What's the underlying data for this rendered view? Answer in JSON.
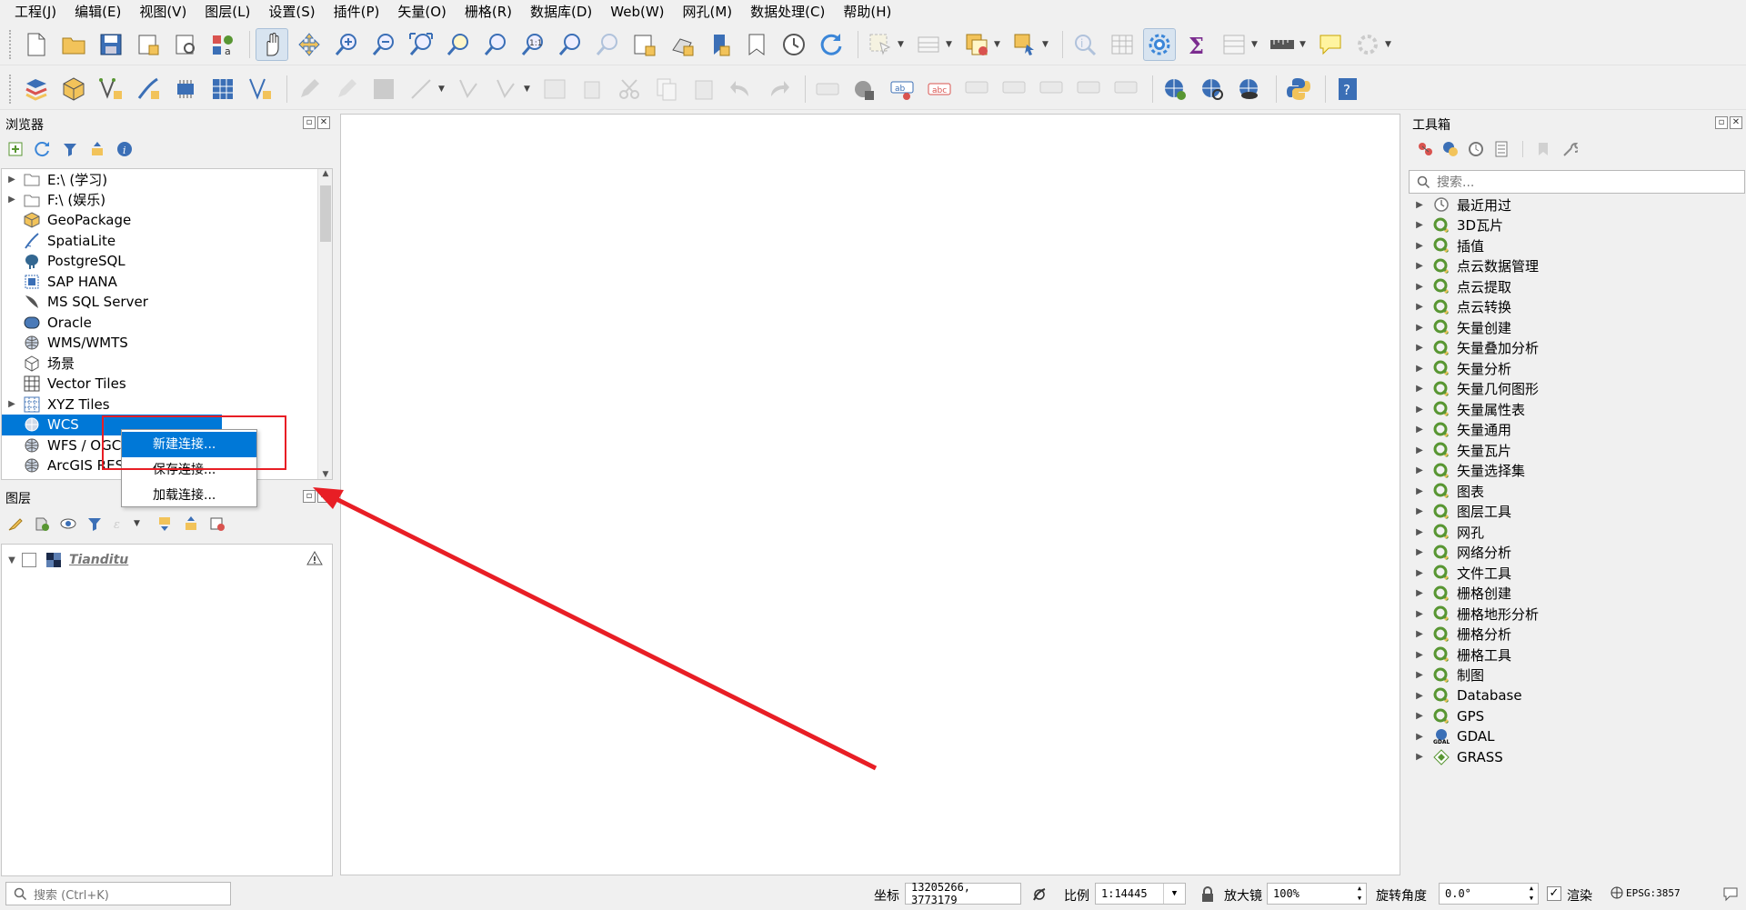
{
  "menu": [
    "工程(J)",
    "编辑(E)",
    "视图(V)",
    "图层(L)",
    "设置(S)",
    "插件(P)",
    "矢量(O)",
    "栅格(R)",
    "数据库(D)",
    "Web(W)",
    "网孔(M)",
    "数据处理(C)",
    "帮助(H)"
  ],
  "browser": {
    "title": "浏览器",
    "items": [
      {
        "label": "E:\\ (学习)",
        "icon": "folder-icon",
        "expandable": true
      },
      {
        "label": "F:\\ (娱乐)",
        "icon": "folder-icon",
        "expandable": true
      },
      {
        "label": "GeoPackage",
        "icon": "geopackage-icon",
        "expandable": false
      },
      {
        "label": "SpatiaLite",
        "icon": "spatialite-icon",
        "expandable": false
      },
      {
        "label": "PostgreSQL",
        "icon": "postgresql-icon",
        "expandable": false
      },
      {
        "label": "SAP HANA",
        "icon": "sap-hana-icon",
        "expandable": false
      },
      {
        "label": "MS SQL Server",
        "icon": "mssql-icon",
        "expandable": false
      },
      {
        "label": "Oracle",
        "icon": "oracle-icon",
        "expandable": false
      },
      {
        "label": "WMS/WMTS",
        "icon": "globe-icon",
        "expandable": false
      },
      {
        "label": "场景",
        "icon": "scene-icon",
        "expandable": false
      },
      {
        "label": "Vector Tiles",
        "icon": "grid-icon",
        "expandable": false
      },
      {
        "label": "XYZ Tiles",
        "icon": "tiles-icon",
        "expandable": true
      },
      {
        "label": "WCS",
        "icon": "globe-icon",
        "expandable": false
      },
      {
        "label": "WFS / OGC",
        "icon": "globe-icon",
        "expandable": false
      },
      {
        "label": "ArcGIS REST",
        "icon": "globe-icon",
        "expandable": false
      }
    ]
  },
  "context_menu": [
    "新建连接...",
    "保存连接...",
    "加载连接..."
  ],
  "layers": {
    "title": "图层",
    "items": [
      {
        "label": "Tiandit​u"
      }
    ]
  },
  "toolbox": {
    "title": "工具箱",
    "search_placeholder": "搜索...",
    "items": [
      "最近用过",
      "3D瓦片",
      "插值",
      "点云数据管理",
      "点云提取",
      "点云转换",
      "矢量创建",
      "矢量叠加分析",
      "矢量分析",
      "矢量几何图形",
      "矢量属性表",
      "矢量通用",
      "矢量瓦片",
      "矢量选择集",
      "图表",
      "图层工具",
      "网孔",
      "网络分析",
      "文件工具",
      "栅格创建",
      "栅格地形分析",
      "栅格分析",
      "栅格工具",
      "制图",
      "Database",
      "GPS",
      "GDAL",
      "GRASS"
    ]
  },
  "status": {
    "search_placeholder": "搜索 (Ctrl+K)",
    "coord_label": "坐标",
    "coord_value": "13205266, 3773179",
    "scale_label": "比例",
    "scale_value": "1:14445",
    "magnifier_label": "放大镜",
    "magnifier_value": "100%",
    "rotation_label": "旋转角度",
    "rotation_value": "0.0°",
    "render_label": "渲染",
    "crs": "EPSG:3857"
  },
  "colors": {
    "accent": "#0078d7",
    "annotation": "#e81e25",
    "qgis_green": "#589632"
  }
}
